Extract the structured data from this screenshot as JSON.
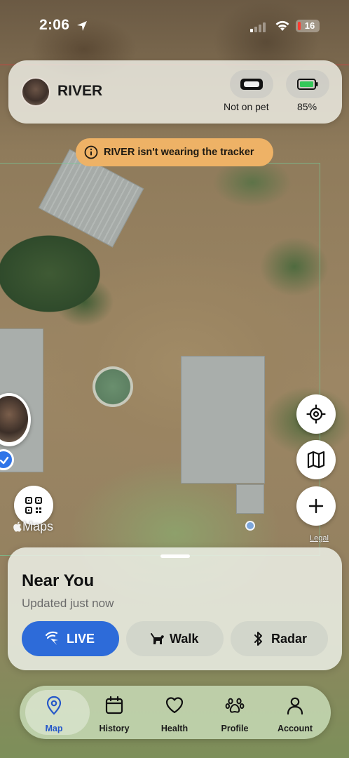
{
  "status_bar": {
    "time": "2:06",
    "battery_level": "16"
  },
  "pet_card": {
    "pet_name": "RIVER",
    "tracker_status": "Not on pet",
    "battery_percent": "85%"
  },
  "warning": {
    "text": "RIVER isn't wearing the tracker",
    "color": "#eeb266"
  },
  "map": {
    "attribution": "Maps",
    "legal_label": "Legal"
  },
  "sheet": {
    "title": "Near You",
    "subtitle": "Updated just now",
    "modes": [
      {
        "label": "LIVE",
        "icon": "live-signal-icon",
        "active": true
      },
      {
        "label": "Walk",
        "icon": "dog-walk-icon",
        "active": false
      },
      {
        "label": "Radar",
        "icon": "bluetooth-icon",
        "active": false
      }
    ]
  },
  "tabs": [
    {
      "label": "Map",
      "icon": "map-pin-icon",
      "active": true
    },
    {
      "label": "History",
      "icon": "calendar-icon",
      "active": false
    },
    {
      "label": "Health",
      "icon": "heart-icon",
      "active": false
    },
    {
      "label": "Profile",
      "icon": "paw-icon",
      "active": false
    },
    {
      "label": "Account",
      "icon": "person-icon",
      "active": false
    }
  ],
  "colors": {
    "accent": "#2d6bd9",
    "active_tab": "#2457c9",
    "battery_low": "#ff3b30",
    "battery_ok": "#34c759"
  }
}
